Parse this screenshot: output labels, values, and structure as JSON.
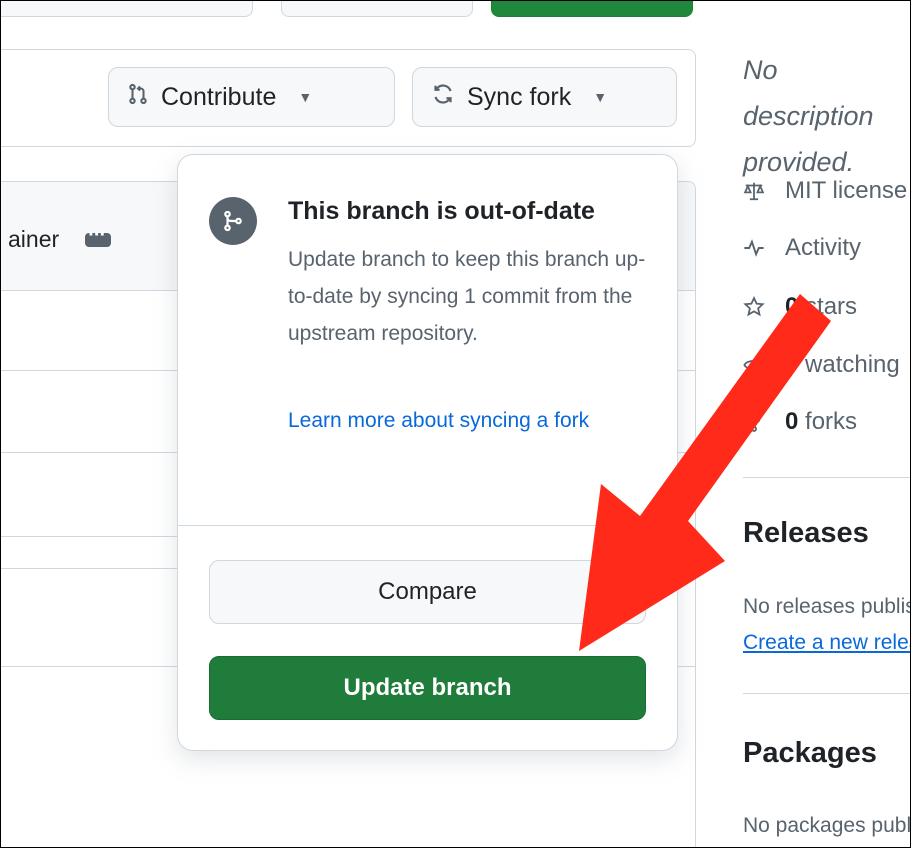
{
  "toolbar": {
    "contribute_label": "Contribute",
    "sync_fork_label": "Sync fork"
  },
  "file_list": {
    "header_text": "ainer"
  },
  "sidebar": {
    "description": "No description provided.",
    "meta": [
      {
        "icon": "law-icon",
        "label": "MIT license",
        "count": ""
      },
      {
        "icon": "pulse-icon",
        "label": "Activity",
        "count": ""
      },
      {
        "icon": "star-icon",
        "label": " stars",
        "count": "0"
      },
      {
        "icon": "eye-icon",
        "label": " watching",
        "count": "0"
      },
      {
        "icon": "repo-forked-icon",
        "label": " forks",
        "count": "0"
      }
    ],
    "releases_title": "Releases",
    "releases_text": "No releases published",
    "releases_link": "Create a new release",
    "packages_title": "Packages",
    "packages_text": "No packages published"
  },
  "popover": {
    "title": "This branch is out-of-date",
    "body": "Update branch to keep this branch up-to-date by syncing 1 commit from the upstream repository.",
    "link": "Learn more about syncing a fork",
    "compare_label": "Compare",
    "update_label": "Update branch"
  },
  "colors": {
    "update_button": "#1f7c3a",
    "link": "#0969da",
    "annotation_arrow": "#ff2a1a"
  }
}
